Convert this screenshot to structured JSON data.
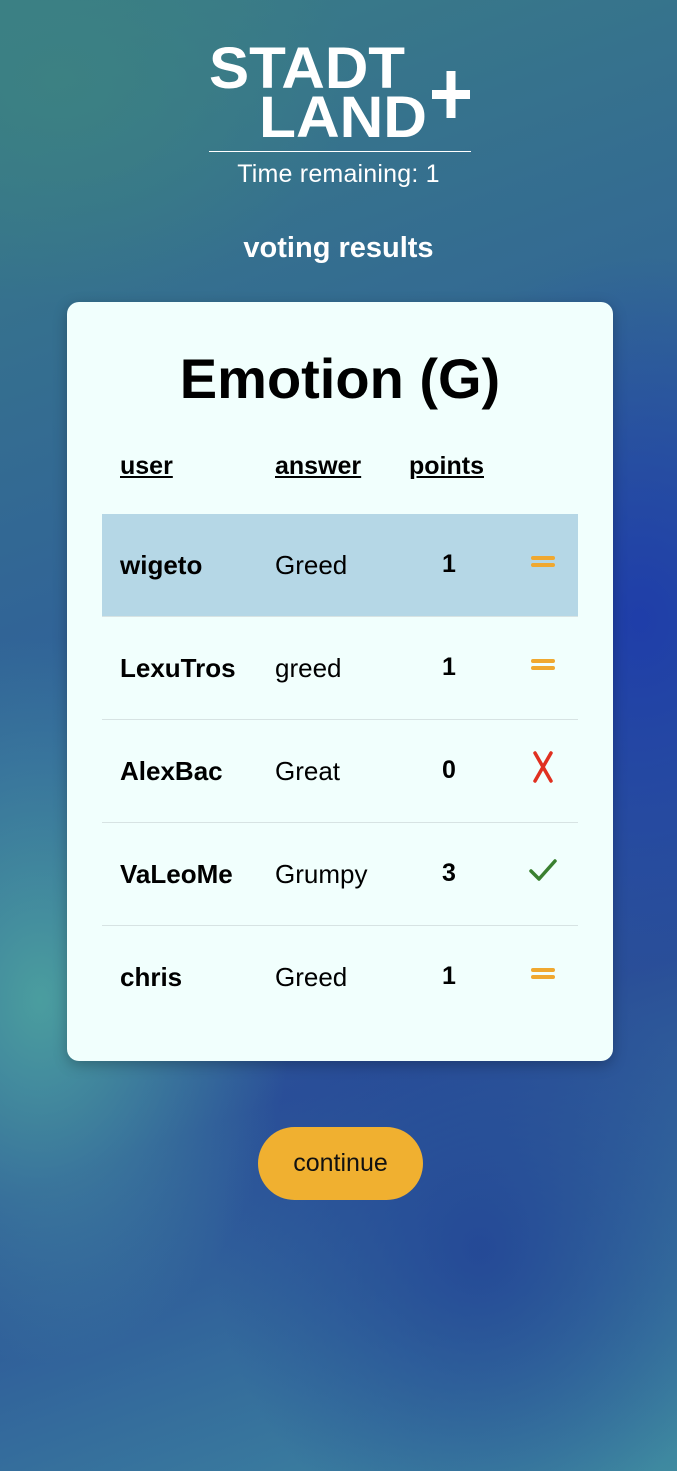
{
  "header": {
    "logo_text": "STADT LAND +",
    "timer_text": "Time remaining: 1",
    "section_title": "voting results"
  },
  "results": {
    "category_title": "Emotion (G)",
    "columns": [
      "user",
      "answer",
      "points"
    ],
    "rows": [
      {
        "user": "wigeto",
        "answer": "Greed",
        "points": "1",
        "vote_icon": "equals-icon",
        "highlighted": true
      },
      {
        "user": "LexuTros",
        "answer": "greed",
        "points": "1",
        "vote_icon": "equals-icon",
        "highlighted": false
      },
      {
        "user": "AlexBac",
        "answer": "Great",
        "points": "0",
        "vote_icon": "cross-icon",
        "highlighted": false
      },
      {
        "user": "VaLeoMe",
        "answer": "Grumpy",
        "points": "3",
        "vote_icon": "check-icon",
        "highlighted": false
      },
      {
        "user": "chris",
        "answer": "Greed",
        "points": "1",
        "vote_icon": "equals-icon",
        "highlighted": false
      }
    ]
  },
  "actions": {
    "continue_label": "continue"
  },
  "colors": {
    "card_background": "#f1fffd",
    "highlight_row": "#b5d7e6",
    "button": "#f0b030",
    "equals_icon": "#f0a830",
    "cross_icon": "#e03020",
    "check_icon": "#3a8030"
  }
}
